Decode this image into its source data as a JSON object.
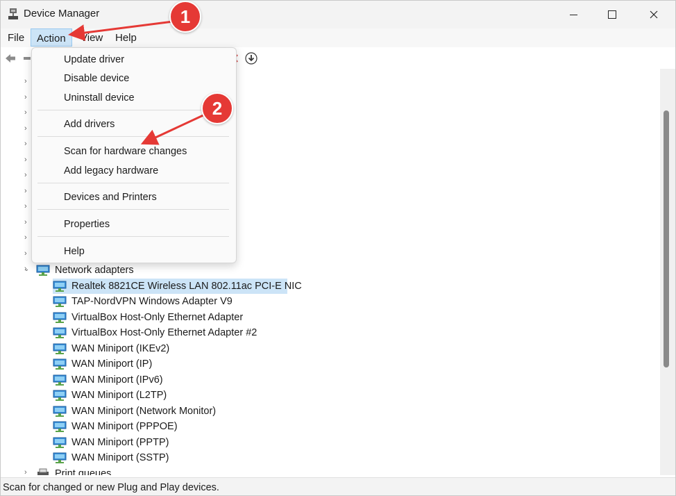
{
  "window": {
    "title": "Device Manager"
  },
  "menu": {
    "file": "File",
    "action": "Action",
    "view": "View",
    "help": "Help"
  },
  "action_menu": {
    "update_driver": "Update driver",
    "disable_device": "Disable device",
    "uninstall_device": "Uninstall device",
    "add_drivers": "Add drivers",
    "scan_hardware": "Scan for hardware changes",
    "add_legacy": "Add legacy hardware",
    "devices_printers": "Devices and Printers",
    "properties": "Properties",
    "help": "Help"
  },
  "tree": {
    "network_adapters": "Network adapters",
    "adapters": [
      "Realtek 8821CE Wireless LAN 802.11ac PCI-E NIC",
      "TAP-NordVPN Windows Adapter V9",
      "VirtualBox Host-Only Ethernet Adapter",
      "VirtualBox Host-Only Ethernet Adapter #2",
      "WAN Miniport (IKEv2)",
      "WAN Miniport (IP)",
      "WAN Miniport (IPv6)",
      "WAN Miniport (L2TP)",
      "WAN Miniport (Network Monitor)",
      "WAN Miniport (PPPOE)",
      "WAN Miniport (PPTP)",
      "WAN Miniport (SSTP)"
    ],
    "print_queues": "Print queues"
  },
  "status": {
    "text": "Scan for changed or new Plug and Play devices."
  },
  "annotations": {
    "step1": "1",
    "step2": "2",
    "badge_color": "#e53935"
  },
  "icons": {
    "app": "device-manager-icon",
    "back": "back-arrow-icon",
    "download": "download-icon",
    "network": "network-adapter-icon",
    "printer": "printer-icon"
  }
}
